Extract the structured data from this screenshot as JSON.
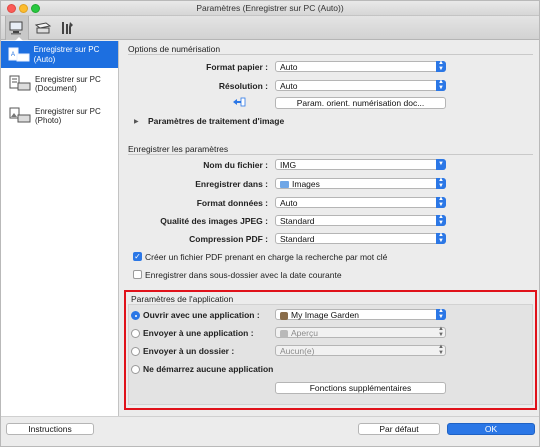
{
  "window": {
    "title": "Paramètres (Enregistrer sur PC (Auto))"
  },
  "toolbar": {
    "tabs": [
      {
        "icon": "scanner-to-pc-icon"
      },
      {
        "icon": "scanner-to-pc-general-icon"
      },
      {
        "icon": "general-settings-tools-icon"
      }
    ]
  },
  "sidebar": {
    "items": [
      {
        "label": "Enregistrer sur PC (Auto)",
        "selected": true,
        "icon": "scan-auto-icon"
      },
      {
        "label": "Enregistrer sur PC (Document)",
        "selected": false,
        "icon": "scan-document-icon"
      },
      {
        "label": "Enregistrer sur PC (Photo)",
        "selected": false,
        "icon": "scan-photo-icon"
      }
    ]
  },
  "scan_options": {
    "title": "Options de numérisation",
    "paper_size_label": "Format papier :",
    "paper_size_value": "Auto",
    "resolution_label": "Résolution :",
    "resolution_value": "Auto",
    "orient_button": "Param. orient. numérisation doc...",
    "image_processing_label": "Paramètres de traitement d'image"
  },
  "save_settings": {
    "title": "Enregistrer les paramètres",
    "filename_label": "Nom du fichier :",
    "filename_value": "IMG",
    "save_in_label": "Enregistrer dans :",
    "save_in_value": "Images",
    "data_format_label": "Format données :",
    "data_format_value": "Auto",
    "jpeg_quality_label": "Qualité des images JPEG :",
    "jpeg_quality_value": "Standard",
    "pdf_compression_label": "Compression PDF :",
    "pdf_compression_value": "Standard",
    "checkbox_pdf_keyword": "Créer un fichier PDF prenant en charge la recherche par mot clé",
    "checkbox_pdf_keyword_checked": true,
    "checkbox_subfolder": "Enregistrer dans sous-dossier avec la date courante",
    "checkbox_subfolder_checked": false
  },
  "app_settings": {
    "title": "Paramètres de l'application",
    "open_app_label": "Ouvrir avec une application :",
    "open_app_value": "My Image Garden",
    "send_app_label": "Envoyer à une application :",
    "send_app_value": "Aperçu",
    "send_folder_label": "Envoyer à un dossier :",
    "send_folder_value": "Aucun(e)",
    "no_app_label": "Ne démarrez aucune application",
    "more_functions_button": "Fonctions supplémentaires",
    "selected_option": "open_app"
  },
  "footer": {
    "instructions_button": "Instructions",
    "defaults_button": "Par défaut",
    "ok_button": "OK"
  },
  "colors": {
    "accent": "#2b77e6",
    "highlight": "#e0111a",
    "selection": "#1d6fe0"
  }
}
